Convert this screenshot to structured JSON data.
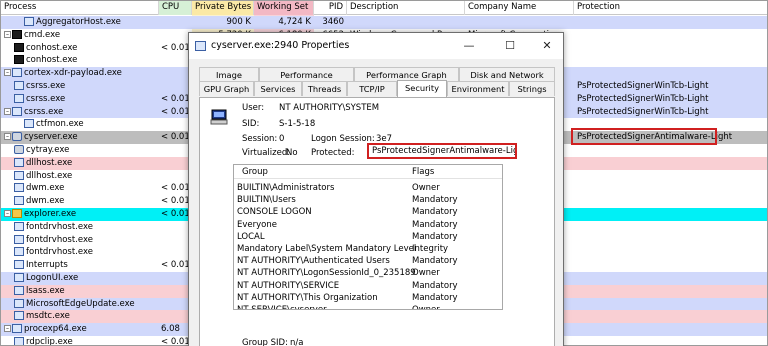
{
  "columns": {
    "process": "Process",
    "cpu": "CPU",
    "private_bytes": "Private Bytes",
    "working_set": "Working Set",
    "pid": "PID",
    "description": "Description",
    "company": "Company Name",
    "protection": "Protection"
  },
  "colors": {
    "service_blue": "#d0d8fb",
    "pink": "#f9cfd3",
    "cyan": "#00f0f6",
    "gray_selected": "#bdbdbd",
    "private_bytes_col": "#fbf2cf",
    "working_set_col": "#f6d3da",
    "highlight_red": "#d02020"
  },
  "processes": [
    {
      "name": "AggregatorHost.exe",
      "cpu": "",
      "pb": "900 K",
      "ws": "4,724 K",
      "pid": "3460",
      "desc": "",
      "comp": "",
      "prot": ""
    },
    {
      "name": "cmd.exe",
      "cpu": "",
      "pb": "5,720 K",
      "ws": "6,180 K",
      "pid": "6652",
      "desc": "Windows Command Processor",
      "comp": "Microsoft Corporation",
      "prot": ""
    },
    {
      "name": "conhost.exe",
      "cpu": "< 0.01",
      "pb": "",
      "ws": "",
      "pid": "",
      "desc": "",
      "comp": "",
      "prot": ""
    },
    {
      "name": "conhost.exe",
      "cpu": "",
      "pb": "",
      "ws": "",
      "pid": "",
      "desc": "",
      "comp": "",
      "prot": ""
    },
    {
      "name": "cortex-xdr-payload.exe",
      "cpu": "",
      "pb": "",
      "ws": "",
      "pid": "",
      "desc": "",
      "comp": "",
      "prot": ""
    },
    {
      "name": "csrss.exe",
      "cpu": "",
      "pb": "",
      "ws": "",
      "pid": "",
      "desc": "",
      "comp": "",
      "prot": "PsProtectedSignerWinTcb-Light"
    },
    {
      "name": "csrss.exe",
      "cpu": "< 0.01",
      "pb": "",
      "ws": "",
      "pid": "",
      "desc": "",
      "comp": "",
      "prot": "PsProtectedSignerWinTcb-Light"
    },
    {
      "name": "csrss.exe",
      "cpu": "< 0.01",
      "pb": "",
      "ws": "",
      "pid": "",
      "desc": "",
      "comp": "",
      "prot": "PsProtectedSignerWinTcb-Light"
    },
    {
      "name": "ctfmon.exe",
      "cpu": "",
      "pb": "",
      "ws": "",
      "pid": "",
      "desc": "",
      "comp": "",
      "prot": ""
    },
    {
      "name": "cyserver.exe",
      "cpu": "< 0.01",
      "pb": "",
      "ws": "",
      "pid": "",
      "desc": "",
      "comp": "",
      "prot": "PsProtectedSignerAntimalware-Light"
    },
    {
      "name": "cytray.exe",
      "cpu": "",
      "pb": "",
      "ws": "",
      "pid": "",
      "desc": "",
      "comp": "",
      "prot": ""
    },
    {
      "name": "dllhost.exe",
      "cpu": "",
      "pb": "",
      "ws": "",
      "pid": "",
      "desc": "",
      "comp": "",
      "prot": ""
    },
    {
      "name": "dllhost.exe",
      "cpu": "",
      "pb": "",
      "ws": "",
      "pid": "",
      "desc": "",
      "comp": "",
      "prot": ""
    },
    {
      "name": "dwm.exe",
      "cpu": "< 0.01",
      "pb": "",
      "ws": "",
      "pid": "",
      "desc": "",
      "comp": "",
      "prot": ""
    },
    {
      "name": "dwm.exe",
      "cpu": "< 0.01",
      "pb": "",
      "ws": "",
      "pid": "",
      "desc": "",
      "comp": "",
      "prot": ""
    },
    {
      "name": "explorer.exe",
      "cpu": "< 0.01",
      "pb": "",
      "ws": "",
      "pid": "",
      "desc": "",
      "comp": "",
      "prot": ""
    },
    {
      "name": "fontdrvhost.exe",
      "cpu": "",
      "pb": "",
      "ws": "",
      "pid": "",
      "desc": "",
      "comp": "",
      "prot": ""
    },
    {
      "name": "fontdrvhost.exe",
      "cpu": "",
      "pb": "",
      "ws": "",
      "pid": "",
      "desc": "",
      "comp": "",
      "prot": ""
    },
    {
      "name": "fontdrvhost.exe",
      "cpu": "",
      "pb": "",
      "ws": "",
      "pid": "",
      "desc": "",
      "comp": "",
      "prot": ""
    },
    {
      "name": "Interrupts",
      "cpu": "< 0.01",
      "pb": "",
      "ws": "",
      "pid": "",
      "desc": "",
      "comp": "",
      "prot": ""
    },
    {
      "name": "LogonUI.exe",
      "cpu": "",
      "pb": "",
      "ws": "",
      "pid": "",
      "desc": "",
      "comp": "",
      "prot": ""
    },
    {
      "name": "lsass.exe",
      "cpu": "",
      "pb": "",
      "ws": "",
      "pid": "",
      "desc": "",
      "comp": "",
      "prot": ""
    },
    {
      "name": "MicrosoftEdgeUpdate.exe",
      "cpu": "",
      "pb": "",
      "ws": "",
      "pid": "",
      "desc": "",
      "comp": "",
      "prot": ""
    },
    {
      "name": "msdtc.exe",
      "cpu": "",
      "pb": "",
      "ws": "",
      "pid": "",
      "desc": "",
      "comp": "",
      "prot": ""
    },
    {
      "name": "procexp64.exe",
      "cpu": "6.08",
      "pb": "",
      "ws": "",
      "pid": "",
      "desc": "",
      "comp": "",
      "prot": ""
    },
    {
      "name": "rdpclip.exe",
      "cpu": "< 0.01",
      "pb": "",
      "ws": "",
      "pid": "",
      "desc": "",
      "comp": "",
      "prot": ""
    }
  ],
  "dialog": {
    "title": "cyserver.exe:2940 Properties",
    "minimize": "—",
    "maximize": "☐",
    "close": "✕",
    "tabs_top": [
      "Image",
      "Performance",
      "Performance Graph",
      "Disk and Network"
    ],
    "tabs_bottom": [
      "GPU Graph",
      "Services",
      "Threads",
      "TCP/IP",
      "Security",
      "Environment",
      "Strings"
    ],
    "user_label": "User:",
    "user_value": "NT AUTHORITY\\SYSTEM",
    "sid_label": "SID:",
    "sid_value": "S-1-5-18",
    "session_label": "Session:",
    "session_value": "0",
    "logon_label": "Logon Session:",
    "logon_value": "3e7",
    "virtualized_label": "Virtualized:",
    "virtualized_value": "No",
    "protected_label": "Protected:",
    "protected_value": "PsProtectedSignerAntimalware-Light",
    "group_header": "Group",
    "flags_header": "Flags",
    "groups": [
      {
        "group": "BUILTIN\\Administrators",
        "flags": "Owner"
      },
      {
        "group": "BUILTIN\\Users",
        "flags": "Mandatory"
      },
      {
        "group": "CONSOLE LOGON",
        "flags": "Mandatory"
      },
      {
        "group": "Everyone",
        "flags": "Mandatory"
      },
      {
        "group": "LOCAL",
        "flags": "Mandatory"
      },
      {
        "group": "Mandatory Label\\System Mandatory Level",
        "flags": "Integrity"
      },
      {
        "group": "NT AUTHORITY\\Authenticated Users",
        "flags": "Mandatory"
      },
      {
        "group": "NT AUTHORITY\\LogonSessionId_0_235189",
        "flags": "Owner"
      },
      {
        "group": "NT AUTHORITY\\SERVICE",
        "flags": "Mandatory"
      },
      {
        "group": "NT AUTHORITY\\This Organization",
        "flags": "Mandatory"
      },
      {
        "group": "NT SERVICE\\cyserver",
        "flags": "Owner"
      }
    ],
    "group_sid_label": "Group SID:",
    "group_sid_value": "n/a"
  }
}
